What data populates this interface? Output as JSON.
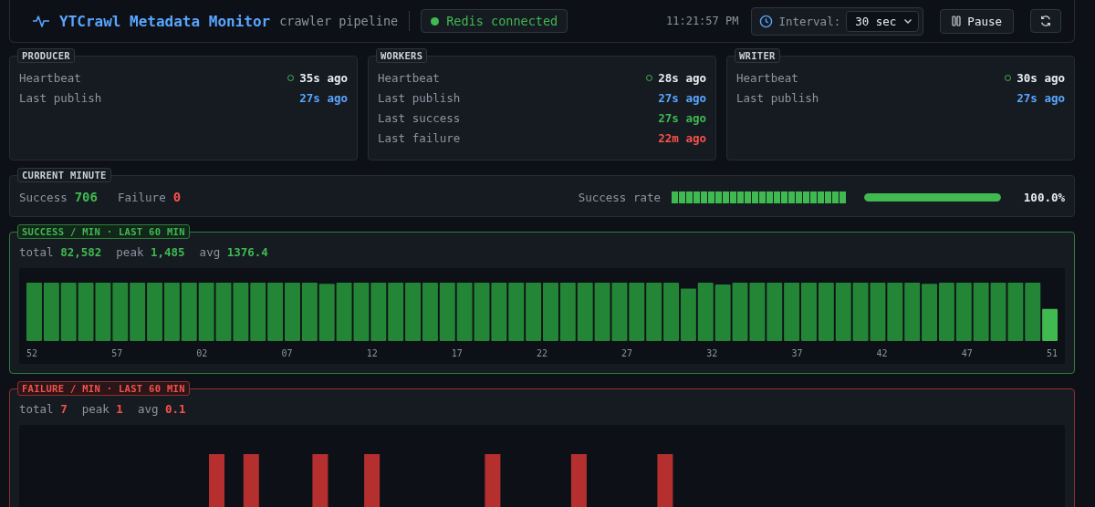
{
  "header": {
    "title": "YTCrawl Metadata Monitor",
    "subtitle": "crawler pipeline",
    "redis": {
      "label": "Redis connected",
      "connected": true
    },
    "clock": "11:21:57 PM",
    "interval": {
      "label": "Interval:",
      "value": "30 sec"
    },
    "pause_button": "Pause"
  },
  "services": [
    {
      "title": "PRODUCER",
      "rows": [
        {
          "label": "Heartbeat",
          "value": "35s ago",
          "kind": "heartbeat"
        },
        {
          "label": "Last publish",
          "value": "27s ago",
          "kind": "publish"
        }
      ]
    },
    {
      "title": "WORKERS",
      "rows": [
        {
          "label": "Heartbeat",
          "value": "28s ago",
          "kind": "heartbeat"
        },
        {
          "label": "Last publish",
          "value": "27s ago",
          "kind": "publish"
        },
        {
          "label": "Last success",
          "value": "27s ago",
          "kind": "success"
        },
        {
          "label": "Last failure",
          "value": "22m ago",
          "kind": "failure"
        }
      ]
    },
    {
      "title": "WRITER",
      "rows": [
        {
          "label": "Heartbeat",
          "value": "30s ago",
          "kind": "heartbeat"
        },
        {
          "label": "Last publish",
          "value": "27s ago",
          "kind": "publish"
        }
      ]
    }
  ],
  "current_minute": {
    "title": "CURRENT MINUTE",
    "success_label": "Success",
    "success": "706",
    "failure_label": "Failure",
    "failure": "0",
    "rate_label": "Success rate",
    "rate": {
      "level": 1
    },
    "rate_text": "100.0%"
  },
  "charts": [
    {
      "kind": "success",
      "title": "SUCCESS / MIN · LAST 60 MIN",
      "stats": [
        {
          "label": "total",
          "value": "82,582"
        },
        {
          "label": "peak",
          "value": "1,485"
        },
        {
          "label": "avg",
          "value": "1376.4"
        }
      ],
      "x_labels": [
        "52",
        "57",
        "02",
        "07",
        "12",
        "17",
        "22",
        "27",
        "32",
        "37",
        "42",
        "47",
        "51"
      ]
    },
    {
      "kind": "failure",
      "title": "FAILURE / MIN · LAST 60 MIN",
      "stats": [
        {
          "label": "total",
          "value": "7"
        },
        {
          "label": "peak",
          "value": "1"
        },
        {
          "label": "avg",
          "value": "0.1"
        }
      ]
    }
  ]
}
